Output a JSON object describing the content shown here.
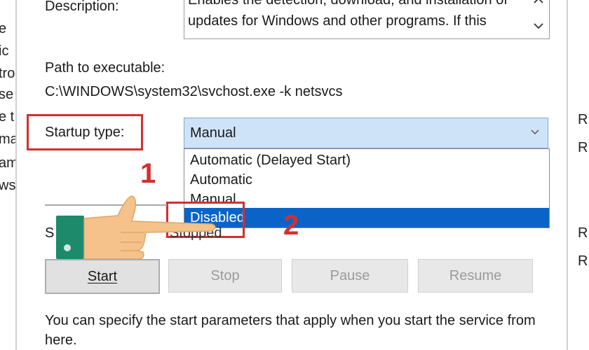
{
  "background_left_fragments": [
    "e",
    "ic",
    "tro",
    "se",
    "e t",
    "ma",
    "am",
    "ws"
  ],
  "background_right_fragments": [
    "R",
    "R",
    "R",
    "R"
  ],
  "description": {
    "label": "Description:",
    "text": "Enables the detection, download, and installation of updates for Windows and other programs. If this"
  },
  "path": {
    "label": "Path to executable:",
    "value": "C:\\WINDOWS\\system32\\svchost.exe -k netsvcs"
  },
  "startup": {
    "label": "Startup type:",
    "selected": "Manual",
    "options": [
      "Automatic (Delayed Start)",
      "Automatic",
      "Manual",
      "Disabled"
    ],
    "highlighted": "Disabled"
  },
  "service_status": {
    "label_partial": "S",
    "value_partial": "Stopped"
  },
  "buttons": {
    "start": "Start",
    "stop": "Stop",
    "pause": "Pause",
    "resume": "Resume"
  },
  "start_params_text": "You can specify the start parameters that apply when you start the service from here.",
  "annotations": {
    "step1": "1",
    "step2": "2"
  },
  "colors": {
    "highlight": "#0a64c8",
    "annotation": "#d32f2f",
    "combo_bg": "#cfe3f8"
  }
}
